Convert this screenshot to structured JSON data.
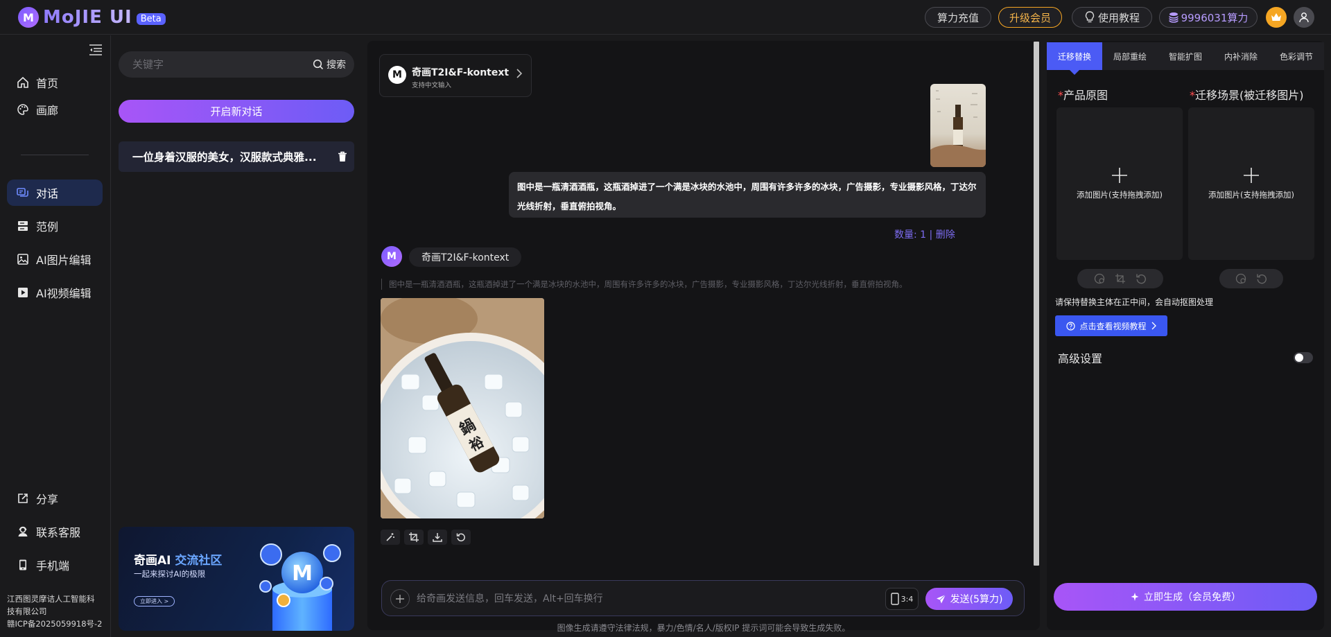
{
  "header": {
    "logo_text": "MoJIE UI",
    "beta_badge": "Beta",
    "recharge_label": "算力充值",
    "upgrade_label": "升级会员",
    "tutorial_label": "使用教程",
    "power_label": "9996031算力"
  },
  "nav": {
    "items": [
      {
        "label": "首页",
        "icon": "home-icon"
      },
      {
        "label": "画廊",
        "icon": "gallery-icon"
      },
      {
        "label": "对话",
        "icon": "chat-icon",
        "active": true
      },
      {
        "label": "范例",
        "icon": "examples-icon"
      },
      {
        "label": "AI图片编辑",
        "icon": "image-edit-icon"
      },
      {
        "label": "AI视频编辑",
        "icon": "video-edit-icon"
      }
    ],
    "bottom_items": [
      {
        "label": "分享",
        "icon": "share-icon"
      },
      {
        "label": "联系客服",
        "icon": "support-icon"
      },
      {
        "label": "手机端",
        "icon": "mobile-icon"
      }
    ],
    "company_line1": "江西图灵摩诘人工智能科",
    "company_line2": "技有限公司",
    "icp": "赣ICP备2025059918号-2"
  },
  "history": {
    "search_placeholder": "关键字",
    "search_button": "搜索",
    "new_chat_label": "开启新对话",
    "conversations": [
      {
        "title": "一位身着汉服的美女，汉服款式典雅..."
      }
    ],
    "banner": {
      "title_main": "奇画AI ",
      "title_highlight": "交流社区",
      "subtitle": "一起来探讨AI的极限",
      "button": "立即进入 >"
    }
  },
  "chat": {
    "model_card": {
      "name": "奇画T2I&F-kontext",
      "subtitle": "支持中文输入"
    },
    "user_message": "图中是一瓶清酒酒瓶，这瓶酒掉进了一个满是冰块的水池中，周围有许多许多的冰块，广告摄影，专业摄影风格，丁达尔光线折射，垂直俯拍视角。",
    "meta_count": "数量: 1",
    "meta_separator": "|",
    "meta_delete": "删除",
    "ai_model_tag": "奇画T2I&F-kontext",
    "ai_prompt": "图中是一瓶清酒酒瓶，这瓶酒掉进了一个满是冰块的水池中，周围有许多许多的冰块，广告摄影，专业摄影风格，丁达尔光线折射，垂直俯拍视角。",
    "composer_placeholder": "给奇画发送信息，回车发送，Alt+回车换行",
    "ratio": "3:4",
    "send_label": "发送(5算力)",
    "disclaimer": "图像生成请遵守法律法规，暴力/色情/名人/版权IP 提示词可能会导致生成失败。"
  },
  "panel": {
    "tabs": [
      "迁移替换",
      "局部重绘",
      "智能扩图",
      "内补消除",
      "色彩调节"
    ],
    "active_tab": 0,
    "product_label": "产品原图",
    "scene_label": "迁移场景(被迁移图片)",
    "required_mark": "*",
    "drop_hint": "添加图片(支持拖拽添加)",
    "tip": "请保持替换主体在正中间，会自动抠图处理",
    "video_btn": "点击查看视频教程",
    "advanced_label": "高级设置",
    "advanced_enabled": false,
    "generate_label": "立即生成（会员免费）"
  },
  "colors": {
    "accent_purple": "#a855f7",
    "accent_blue": "#4b5bf5",
    "vip_orange": "#f6a623"
  }
}
